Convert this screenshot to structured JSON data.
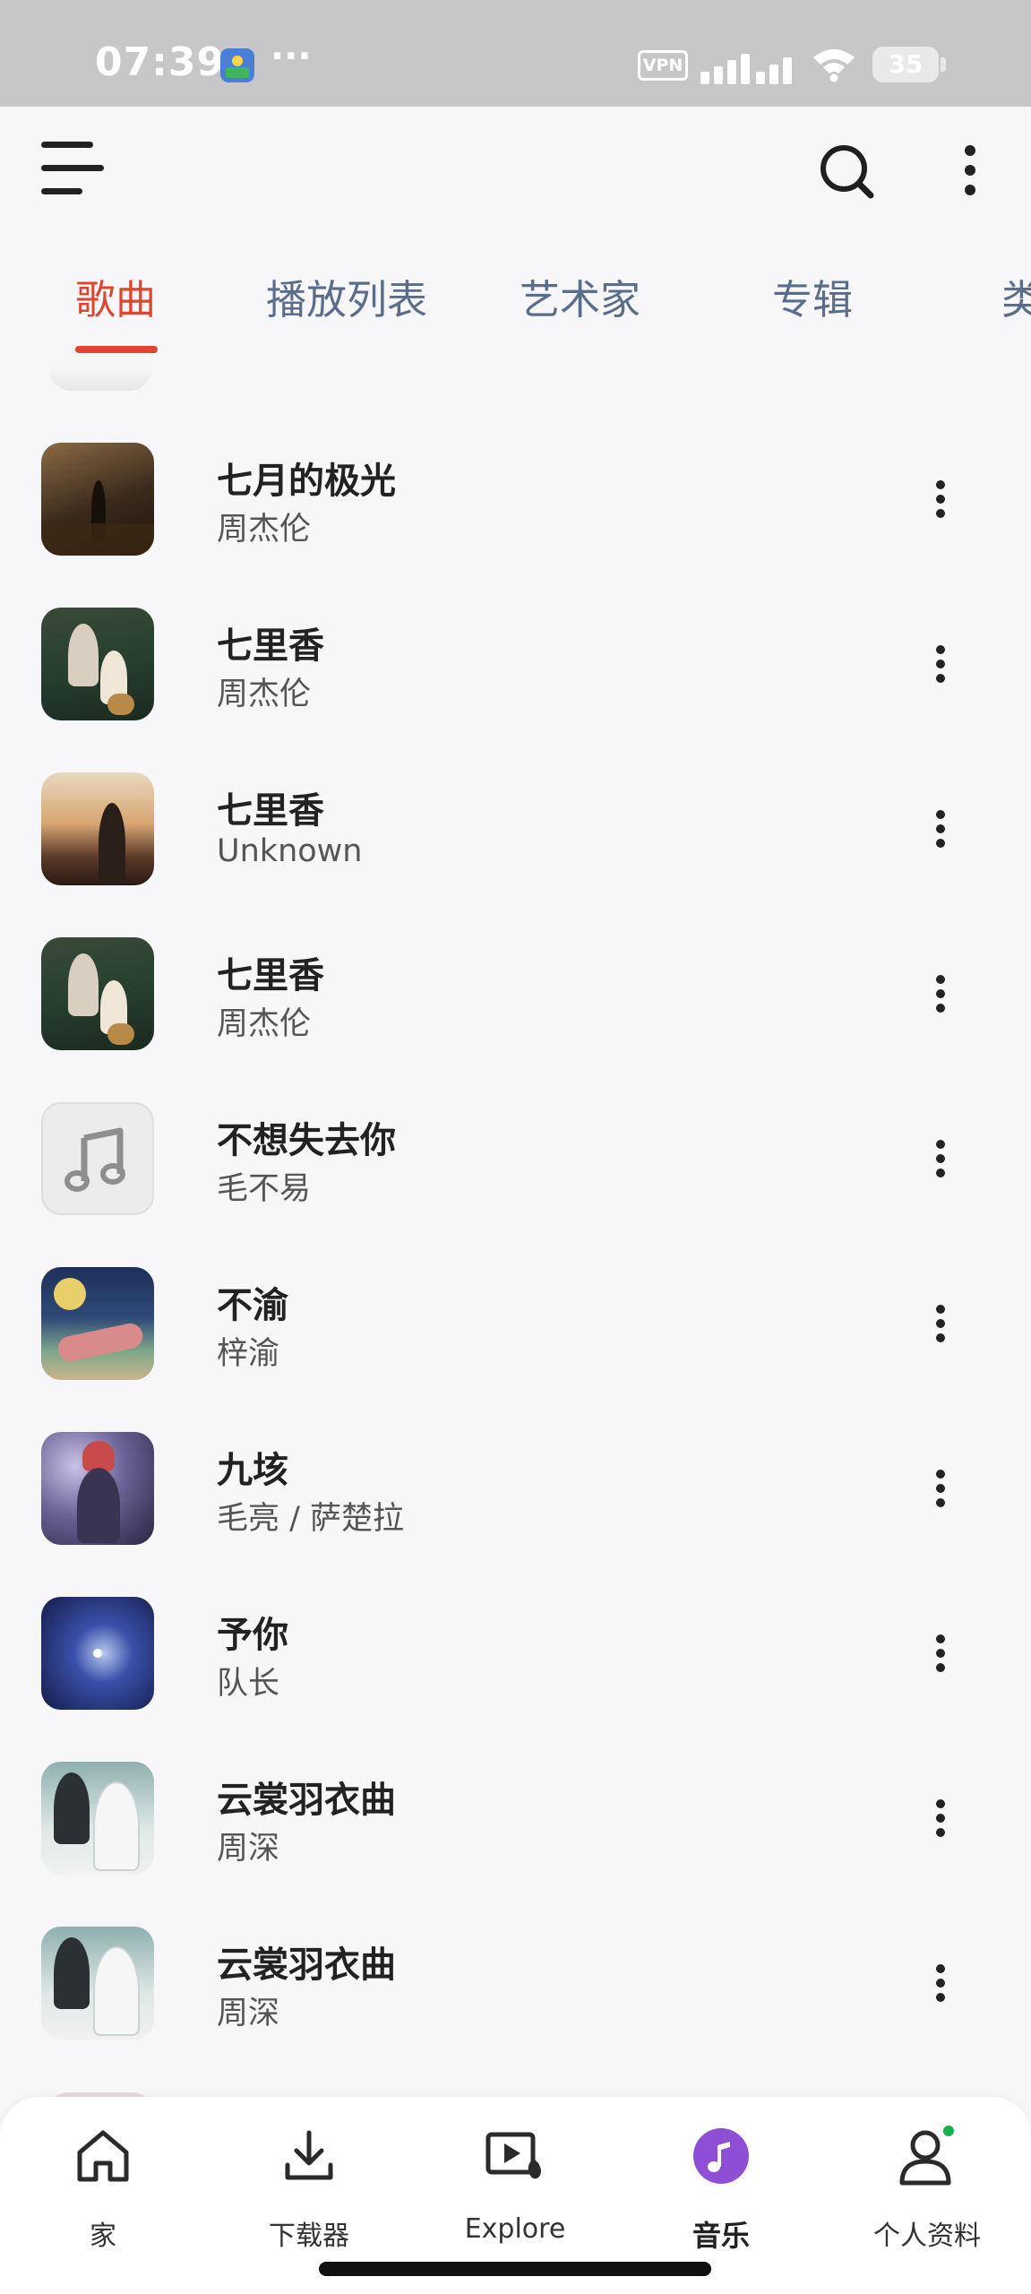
{
  "status_bar": {
    "time": "07:39",
    "overflow": "···",
    "vpn_label": "VPN",
    "battery": "35",
    "icons": [
      "gallery-app-icon",
      "signal-icon",
      "wifi-icon",
      "battery-icon"
    ]
  },
  "header": {
    "icons": [
      "menu-icon",
      "search-icon",
      "more-vertical-icon"
    ]
  },
  "tabs": [
    {
      "label": "歌曲",
      "active": true
    },
    {
      "label": "播放列表",
      "active": false
    },
    {
      "label": "艺术家",
      "active": false
    },
    {
      "label": "专辑",
      "active": false
    },
    {
      "label": "类",
      "active": false
    }
  ],
  "songs": [
    {
      "title": "七月的极光",
      "artist": "周杰伦"
    },
    {
      "title": "七里香",
      "artist": "周杰伦"
    },
    {
      "title": "七里香",
      "artist": "Unknown"
    },
    {
      "title": "七里香",
      "artist": "周杰伦"
    },
    {
      "title": "不想失去你",
      "artist": "毛不易"
    },
    {
      "title": "不渝",
      "artist": "梓渝"
    },
    {
      "title": "九垓",
      "artist": "毛亮 / 萨楚拉"
    },
    {
      "title": "予你",
      "artist": "队长"
    },
    {
      "title": "云裳羽衣曲",
      "artist": "周深"
    },
    {
      "title": "云裳羽衣曲",
      "artist": "周深"
    }
  ],
  "bottom_nav": [
    {
      "label": "家",
      "icon": "home-icon",
      "active": false
    },
    {
      "label": "下载器",
      "icon": "download-icon",
      "active": false
    },
    {
      "label": "Explore",
      "icon": "explore-video-icon",
      "active": false
    },
    {
      "label": "音乐",
      "icon": "music-note-icon",
      "active": true
    },
    {
      "label": "个人资料",
      "icon": "profile-icon",
      "active": false
    }
  ],
  "colors": {
    "accent": "#e0462f",
    "tab_inactive": "#5a6e8c",
    "music_active": "#8e4fd6",
    "notification_dot": "#18b04a"
  }
}
